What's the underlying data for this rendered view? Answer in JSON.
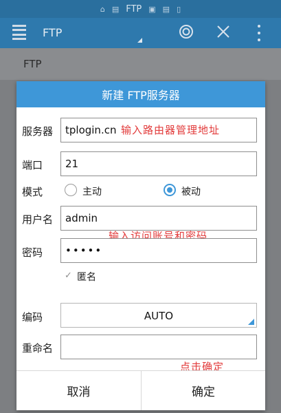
{
  "status_bar": {
    "title": "FTP"
  },
  "app_bar": {
    "title": "FTP"
  },
  "path_bar": {
    "path": "FTP"
  },
  "dialog": {
    "title": "新建 FTP服务器",
    "server": {
      "label": "服务器",
      "value": "tplogin.cn",
      "annotation": "输入路由器管理地址"
    },
    "port": {
      "label": "端口",
      "value": "21"
    },
    "mode": {
      "label": "模式",
      "options": [
        {
          "label": "主动",
          "selected": false
        },
        {
          "label": "被动",
          "selected": true
        }
      ]
    },
    "username": {
      "label": "用户名",
      "value": "admin",
      "annotation": "输入访问账号和密码"
    },
    "password": {
      "label": "密码",
      "value": "•••••"
    },
    "anonymous": {
      "label": "匿名",
      "checked": true
    },
    "encoding": {
      "label": "编码",
      "value": "AUTO"
    },
    "rename": {
      "label": "重命名",
      "value": ""
    },
    "confirm_annotation": "点击确定",
    "cancel_label": "取消",
    "ok_label": "确定"
  },
  "colors": {
    "accent": "#3e97d8",
    "app_bar": "#2e79ad",
    "annotation": "#e23b3b"
  },
  "icons": [
    "menu-icon",
    "check-circle-icon",
    "close-icon",
    "more-vert-icon",
    "home-icon",
    "folder-icon",
    "checkbox-check-icon"
  ]
}
